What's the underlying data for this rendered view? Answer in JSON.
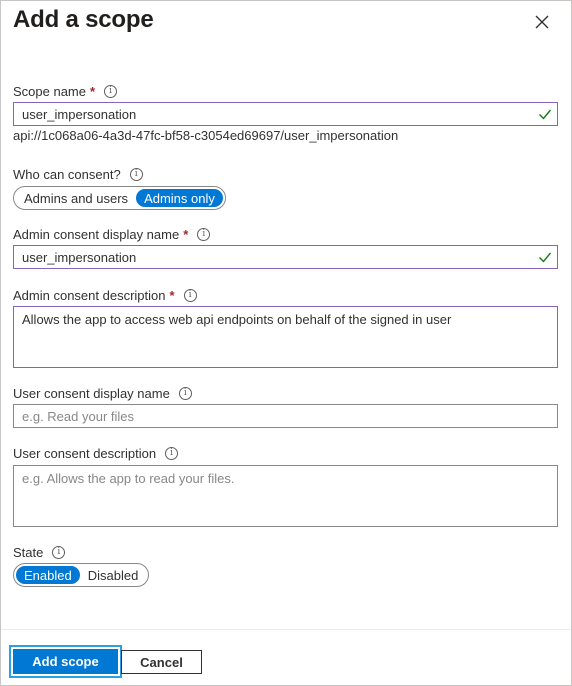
{
  "panel": {
    "title": "Add a scope",
    "close_icon": "close-icon"
  },
  "scope_name": {
    "label": "Scope name",
    "required": "*",
    "value": "user_impersonation",
    "uri": "api://1c068a06-4a3d-47fc-bf58-c3054ed69697/user_impersonation"
  },
  "who_can_consent": {
    "label": "Who can consent?",
    "options": [
      "Admins and users",
      "Admins only"
    ],
    "selected": "Admins only"
  },
  "admin_display_name": {
    "label": "Admin consent display name",
    "required": "*",
    "value": "user_impersonation"
  },
  "admin_description": {
    "label": "Admin consent description",
    "required": "*",
    "value": "Allows the app to access web api endpoints on behalf of the signed in user"
  },
  "user_display_name": {
    "label": "User consent display name",
    "placeholder": "e.g. Read your files"
  },
  "user_description": {
    "label": "User consent description",
    "placeholder": "e.g. Allows the app to read your files."
  },
  "state": {
    "label": "State",
    "options": [
      "Enabled",
      "Disabled"
    ],
    "selected": "Enabled"
  },
  "footer": {
    "add_label": "Add scope",
    "cancel_label": "Cancel"
  },
  "colors": {
    "accent": "#0078d4",
    "valid_border": "#8764b8",
    "check": "#107c10",
    "required": "#a4262c"
  }
}
